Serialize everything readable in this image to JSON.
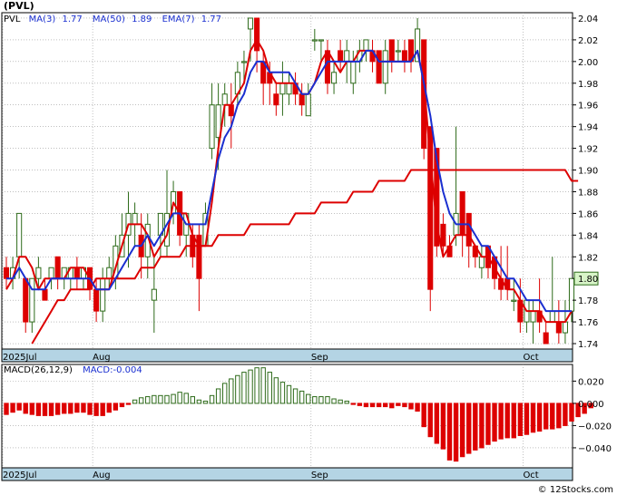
{
  "title": "(PVL)",
  "watermark": "© 12Stocks.com",
  "colors": {
    "up": "#2e6b1a",
    "down": "#dd0000",
    "ma_short": "#dd0000",
    "ma_long": "#dd0000",
    "ema": "#1a2fd0",
    "axis_band": "#b4d4e4",
    "grid": "#999999",
    "price_badge": "#d8f5c8"
  },
  "legend": {
    "ticker": "PVL",
    "ma3_label": "MA(3)",
    "ma3_value": "1.77",
    "ma50_label": "MA(50)",
    "ma50_value": "1.89",
    "ema7_label": "EMA(7)",
    "ema7_value": "1.77"
  },
  "macd_legend": {
    "params": "MACD(26,12,9)",
    "value_text": "MACD:-0.004"
  },
  "last_price": "1.80",
  "chart_data": [
    {
      "type": "candlestick",
      "title": "(PVL)",
      "ylim": [
        1.735,
        2.045
      ],
      "yticks": [
        1.74,
        1.76,
        1.78,
        1.8,
        1.82,
        1.84,
        1.86,
        1.88,
        1.9,
        1.92,
        1.94,
        1.96,
        1.98,
        2.0,
        2.02,
        2.04
      ],
      "ytick_labels": [
        "1.74",
        "1.76",
        "1.78",
        "1.80",
        "1.82",
        "1.84",
        "1.86",
        "1.88",
        "1.90",
        "1.92",
        "1.94",
        "1.96",
        "1.98",
        "2.00",
        "2.02",
        "2.04"
      ],
      "xtick_labels": [
        {
          "label": "2025Jul",
          "index": 0
        },
        {
          "label": "Aug",
          "index": 14
        },
        {
          "label": "Sep",
          "index": 48
        },
        {
          "label": "Oct",
          "index": 81
        }
      ],
      "candles": [
        [
          1.81,
          1.8,
          1.82,
          1.79
        ],
        [
          1.8,
          1.81,
          1.82,
          1.79
        ],
        [
          1.82,
          1.86,
          1.86,
          1.8
        ],
        [
          1.8,
          1.76,
          1.8,
          1.75
        ],
        [
          1.76,
          1.8,
          1.8,
          1.75
        ],
        [
          1.8,
          1.81,
          1.82,
          1.79
        ],
        [
          1.79,
          1.78,
          1.8,
          1.78
        ],
        [
          1.8,
          1.81,
          1.81,
          1.79
        ],
        [
          1.82,
          1.8,
          1.82,
          1.79
        ],
        [
          1.8,
          1.81,
          1.81,
          1.79
        ],
        [
          1.8,
          1.81,
          1.81,
          1.79
        ],
        [
          1.81,
          1.8,
          1.82,
          1.79
        ],
        [
          1.8,
          1.81,
          1.81,
          1.79
        ],
        [
          1.81,
          1.79,
          1.81,
          1.78
        ],
        [
          1.79,
          1.77,
          1.8,
          1.76
        ],
        [
          1.77,
          1.8,
          1.81,
          1.76
        ],
        [
          1.8,
          1.81,
          1.82,
          1.79
        ],
        [
          1.8,
          1.83,
          1.84,
          1.79
        ],
        [
          1.82,
          1.84,
          1.86,
          1.82
        ],
        [
          1.84,
          1.86,
          1.88,
          1.81
        ],
        [
          1.85,
          1.86,
          1.87,
          1.83
        ],
        [
          1.84,
          1.82,
          1.86,
          1.8
        ],
        [
          1.82,
          1.85,
          1.86,
          1.8
        ],
        [
          1.78,
          1.79,
          1.82,
          1.75
        ],
        [
          1.84,
          1.86,
          1.86,
          1.82
        ],
        [
          1.83,
          1.86,
          1.9,
          1.82
        ],
        [
          1.86,
          1.88,
          1.89,
          1.85
        ],
        [
          1.88,
          1.84,
          1.88,
          1.83
        ],
        [
          1.84,
          1.86,
          1.86,
          1.82
        ],
        [
          1.84,
          1.82,
          1.85,
          1.81
        ],
        [
          1.84,
          1.8,
          1.85,
          1.77
        ],
        [
          1.83,
          1.86,
          1.87,
          1.83
        ],
        [
          1.92,
          1.96,
          1.98,
          1.91
        ],
        [
          1.93,
          1.96,
          1.98,
          1.9
        ],
        [
          1.96,
          1.97,
          1.98,
          1.94
        ],
        [
          1.96,
          1.95,
          1.98,
          1.92
        ],
        [
          1.97,
          1.99,
          2.0,
          1.96
        ],
        [
          2.0,
          2.0,
          2.01,
          1.98
        ],
        [
          2.03,
          2.04,
          2.04,
          2.0
        ],
        [
          2.04,
          2.01,
          2.04,
          1.99
        ],
        [
          2.0,
          1.98,
          2.01,
          1.96
        ],
        [
          1.99,
          1.98,
          2.0,
          1.96
        ],
        [
          1.97,
          1.96,
          1.98,
          1.95
        ],
        [
          1.97,
          1.98,
          2.0,
          1.95
        ],
        [
          1.97,
          1.98,
          1.99,
          1.96
        ],
        [
          1.98,
          1.97,
          1.99,
          1.96
        ],
        [
          1.97,
          1.96,
          1.98,
          1.95
        ],
        [
          1.95,
          1.97,
          1.98,
          1.95
        ],
        [
          2.02,
          2.02,
          2.03,
          2.01
        ],
        [
          2.02,
          2.02,
          2.02,
          2.0
        ],
        [
          2.01,
          1.98,
          2.02,
          1.97
        ],
        [
          1.98,
          1.99,
          2.0,
          1.97
        ],
        [
          2.01,
          2.0,
          2.02,
          1.99
        ],
        [
          2.0,
          2.01,
          2.02,
          1.98
        ],
        [
          1.98,
          2.0,
          2.01,
          1.97
        ],
        [
          2.0,
          2.01,
          2.02,
          1.99
        ],
        [
          2.01,
          2.02,
          2.02,
          2.0
        ],
        [
          2.01,
          2.0,
          2.02,
          1.99
        ],
        [
          2.01,
          1.98,
          2.01,
          1.98
        ],
        [
          1.98,
          2.01,
          2.02,
          1.97
        ],
        [
          2.02,
          2.0,
          2.02,
          1.99
        ],
        [
          2.01,
          2.01,
          2.02,
          2.0
        ],
        [
          2.01,
          2.0,
          2.02,
          1.99
        ],
        [
          2.02,
          2.0,
          2.02,
          1.99
        ],
        [
          2.0,
          2.03,
          2.04,
          2.0
        ],
        [
          2.02,
          1.92,
          2.02,
          1.91
        ],
        [
          1.94,
          1.79,
          1.94,
          1.77
        ],
        [
          1.92,
          1.83,
          1.92,
          1.82
        ],
        [
          1.85,
          1.83,
          1.86,
          1.82
        ],
        [
          1.83,
          1.82,
          1.84,
          1.82
        ],
        [
          1.84,
          1.86,
          1.94,
          1.83
        ],
        [
          1.88,
          1.84,
          1.88,
          1.82
        ],
        [
          1.86,
          1.83,
          1.86,
          1.81
        ],
        [
          1.83,
          1.82,
          1.83,
          1.81
        ],
        [
          1.81,
          1.82,
          1.83,
          1.8
        ],
        [
          1.83,
          1.81,
          1.83,
          1.8
        ],
        [
          1.82,
          1.8,
          1.82,
          1.79
        ],
        [
          1.8,
          1.79,
          1.83,
          1.78
        ],
        [
          1.8,
          1.79,
          1.83,
          1.78
        ],
        [
          1.78,
          1.78,
          1.8,
          1.77
        ],
        [
          1.78,
          1.76,
          1.8,
          1.75
        ],
        [
          1.76,
          1.78,
          1.78,
          1.75
        ],
        [
          1.76,
          1.77,
          1.78,
          1.74
        ],
        [
          1.77,
          1.76,
          1.8,
          1.75
        ],
        [
          1.75,
          1.74,
          1.76,
          1.74
        ],
        [
          1.76,
          1.77,
          1.82,
          1.76
        ],
        [
          1.76,
          1.75,
          1.78,
          1.74
        ],
        [
          1.75,
          1.76,
          1.78,
          1.74
        ],
        [
          1.77,
          1.8,
          1.8,
          1.76
        ]
      ],
      "series": [
        {
          "name": "MA(3)",
          "values": [
            1.79,
            1.8,
            1.82,
            1.82,
            1.81,
            1.79,
            1.8,
            1.8,
            1.8,
            1.8,
            1.81,
            1.81,
            1.81,
            1.8,
            1.79,
            1.79,
            1.79,
            1.81,
            1.83,
            1.85,
            1.85,
            1.85,
            1.84,
            1.82,
            1.83,
            1.84,
            1.87,
            1.86,
            1.86,
            1.84,
            1.83,
            1.83,
            1.87,
            1.92,
            1.96,
            1.96,
            1.97,
            1.98,
            2.01,
            2.02,
            2.01,
            1.99,
            1.98,
            1.98,
            1.98,
            1.98,
            1.97,
            1.97,
            1.98,
            2.0,
            2.01,
            2.0,
            1.99,
            2.0,
            2.0,
            2.01,
            2.01,
            2.01,
            2.0,
            2.0,
            2.0,
            2.0,
            2.0,
            2.0,
            2.01,
            1.98,
            1.91,
            1.85,
            1.82,
            1.83,
            1.84,
            1.84,
            1.84,
            1.83,
            1.82,
            1.82,
            1.81,
            1.8,
            1.79,
            1.79,
            1.78,
            1.77,
            1.77,
            1.77,
            1.76,
            1.76,
            1.76,
            1.76,
            1.77
          ]
        },
        {
          "name": "MA(50)",
          "start": 4,
          "values": [
            1.74,
            1.75,
            1.76,
            1.77,
            1.78,
            1.78,
            1.79,
            1.79,
            1.79,
            1.79,
            1.8,
            1.8,
            1.8,
            1.8,
            1.8,
            1.8,
            1.8,
            1.81,
            1.81,
            1.81,
            1.82,
            1.82,
            1.82,
            1.82,
            1.83,
            1.83,
            1.83,
            1.83,
            1.83,
            1.84,
            1.84,
            1.84,
            1.84,
            1.84,
            1.85,
            1.85,
            1.85,
            1.85,
            1.85,
            1.85,
            1.85,
            1.86,
            1.86,
            1.86,
            1.86,
            1.87,
            1.87,
            1.87,
            1.87,
            1.87,
            1.88,
            1.88,
            1.88,
            1.88,
            1.89,
            1.89,
            1.89,
            1.89,
            1.89,
            1.9,
            1.9,
            1.9,
            1.9,
            1.9,
            1.9,
            1.9,
            1.9,
            1.9,
            1.9,
            1.9,
            1.9,
            1.9,
            1.9,
            1.9,
            1.9,
            1.9,
            1.9,
            1.9,
            1.9,
            1.9,
            1.9,
            1.9,
            1.9,
            1.9,
            1.89,
            1.89
          ]
        },
        {
          "name": "EMA(7)",
          "values": [
            1.8,
            1.8,
            1.81,
            1.8,
            1.79,
            1.79,
            1.79,
            1.8,
            1.8,
            1.8,
            1.8,
            1.8,
            1.8,
            1.8,
            1.79,
            1.79,
            1.79,
            1.8,
            1.81,
            1.82,
            1.83,
            1.83,
            1.84,
            1.83,
            1.84,
            1.85,
            1.86,
            1.86,
            1.85,
            1.85,
            1.85,
            1.85,
            1.88,
            1.91,
            1.93,
            1.94,
            1.96,
            1.97,
            1.99,
            2.0,
            2.0,
            1.99,
            1.99,
            1.99,
            1.99,
            1.98,
            1.97,
            1.97,
            1.98,
            1.99,
            2.0,
            2.0,
            2.0,
            2.0,
            2.0,
            2.0,
            2.01,
            2.01,
            2.0,
            2.0,
            2.0,
            2.0,
            2.0,
            2.0,
            2.01,
            1.98,
            1.95,
            1.91,
            1.88,
            1.86,
            1.85,
            1.85,
            1.85,
            1.84,
            1.83,
            1.83,
            1.82,
            1.81,
            1.8,
            1.8,
            1.79,
            1.78,
            1.78,
            1.78,
            1.77,
            1.77,
            1.77,
            1.77,
            1.77
          ]
        }
      ]
    },
    {
      "type": "bar",
      "title": "MACD(26,12,9)",
      "ylim": [
        -0.058,
        0.035
      ],
      "yticks": [
        0.02,
        0.0,
        -0.02,
        -0.04
      ],
      "ytick_labels": [
        "0.020",
        "0.000",
        "−0.020",
        "−0.040"
      ],
      "xtick_labels": [
        {
          "label": "2025Jul",
          "index": 0
        },
        {
          "label": "Aug",
          "index": 14
        },
        {
          "label": "Sep",
          "index": 48
        },
        {
          "label": "Oct",
          "index": 81
        }
      ],
      "values": [
        -0.01,
        -0.008,
        -0.006,
        -0.009,
        -0.01,
        -0.011,
        -0.011,
        -0.011,
        -0.01,
        -0.009,
        -0.009,
        -0.008,
        -0.008,
        -0.01,
        -0.011,
        -0.011,
        -0.008,
        -0.006,
        -0.003,
        -0.001,
        0.003,
        0.005,
        0.006,
        0.007,
        0.007,
        0.007,
        0.008,
        0.01,
        0.009,
        0.006,
        0.003,
        0.002,
        0.007,
        0.013,
        0.018,
        0.022,
        0.025,
        0.028,
        0.03,
        0.032,
        0.032,
        0.028,
        0.023,
        0.019,
        0.016,
        0.013,
        0.011,
        0.008,
        0.006,
        0.006,
        0.006,
        0.004,
        0.003,
        0.002,
        -0.001,
        -0.002,
        -0.003,
        -0.003,
        -0.003,
        -0.003,
        -0.004,
        -0.002,
        -0.003,
        -0.005,
        -0.007,
        -0.021,
        -0.03,
        -0.036,
        -0.041,
        -0.051,
        -0.052,
        -0.048,
        -0.045,
        -0.042,
        -0.04,
        -0.037,
        -0.034,
        -0.032,
        -0.031,
        -0.031,
        -0.029,
        -0.028,
        -0.026,
        -0.025,
        -0.023,
        -0.023,
        -0.022,
        -0.02,
        -0.016,
        -0.012,
        -0.009,
        -0.004
      ]
    }
  ]
}
